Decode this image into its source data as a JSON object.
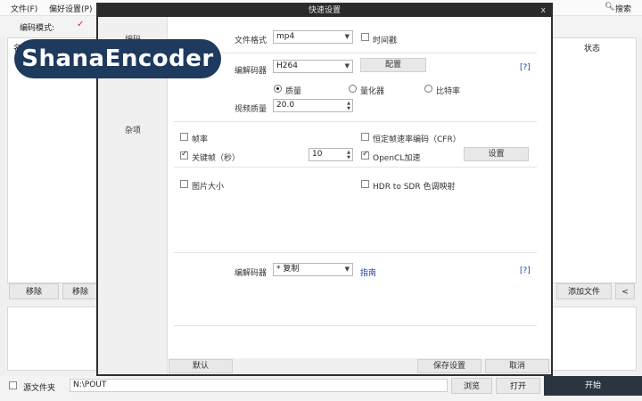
{
  "app": {
    "menu": {
      "file": "文件(F)",
      "prefs": "偏好设置(P)",
      "search": "搜索"
    },
    "encode_mode_label": "编码模式:",
    "list_col_name": "名",
    "list_col_status": "状态",
    "remove_label": "移除",
    "remove2_label": "移除",
    "add_file_label": "添加文件",
    "collapse_label": "<",
    "source_folder_label": "源文件夹",
    "output_path": "N:\\POUT",
    "browse_label": "浏览",
    "open_label": "打开",
    "start_label": "开始"
  },
  "watermark": "ShanaEncoder",
  "dialog": {
    "title": "快速设置",
    "close": "x",
    "side_items": [
      "编码",
      "杂项"
    ],
    "format_label": "文件格式",
    "format_value": "mp4",
    "timestamp_label": "时间戳",
    "codec_label": "编解码器",
    "codec_value": "H264",
    "config_label": "配置",
    "help": "[?]",
    "radio_quality": "质量",
    "radio_quantizer": "量化器",
    "radio_bitrate": "比特率",
    "quality_label": "视频质量",
    "quality_value": "20.0",
    "fps_label": "帧率",
    "cfr_label": "恒定帧速率编码（CFR）",
    "keyframe_label": "关键帧（秒）",
    "keyframe_value": "10",
    "opencl_label": "OpenCL加速",
    "opencl_settings": "设置",
    "picsize_label": "图片大小",
    "hdr_label": "HDR to SDR 色调映射",
    "audio_codec_label": "编解码器",
    "audio_codec_value": "* 复制",
    "guide_label": "指南",
    "help2": "[?]",
    "default_label": "默认",
    "save_label": "保存设置",
    "cancel_label": "取消"
  },
  "colors": {
    "dialog_title_bg": "#2b2b2b",
    "link": "#1e3fa8",
    "start_bg": "#2b3542",
    "watermark_bg": "#1e3a5f"
  }
}
